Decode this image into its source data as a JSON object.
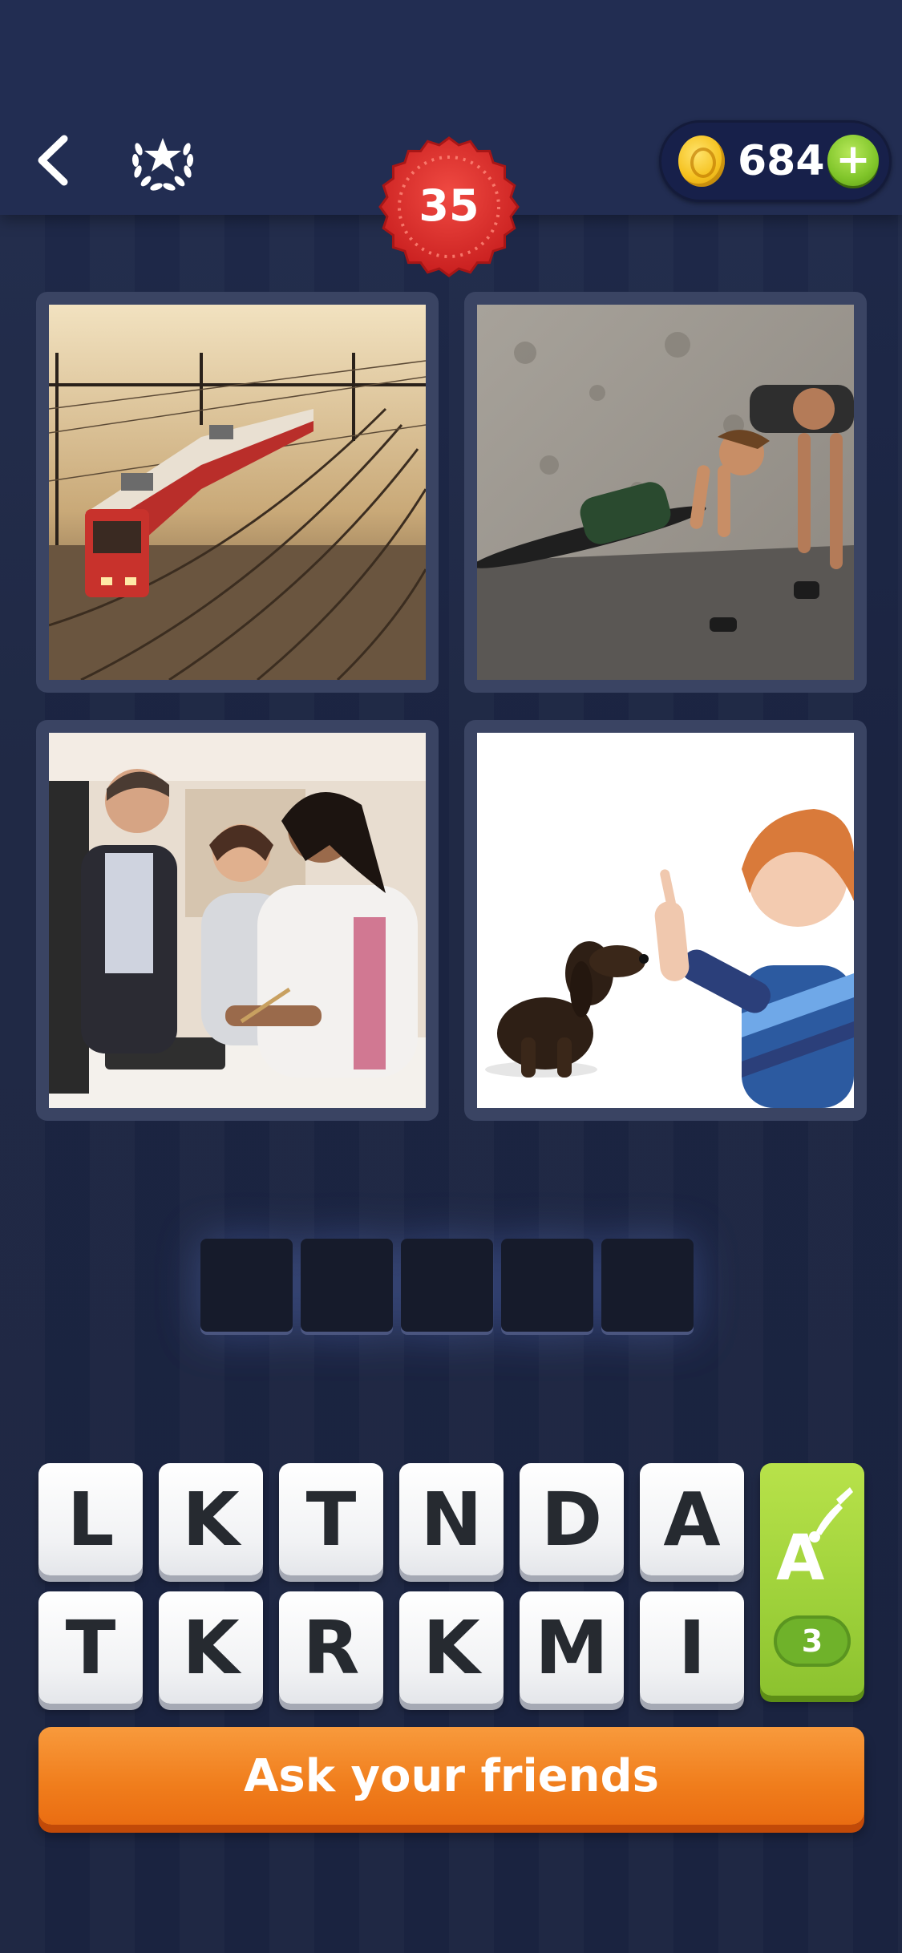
{
  "header": {
    "level": "35",
    "coins": "684",
    "plus_label": "+",
    "back_icon": "chevron-left-icon",
    "laurel_icon": "laurel-star-icon",
    "coin_icon": "coin-icon"
  },
  "pictures": [
    {
      "name": "train-on-tracks"
    },
    {
      "name": "women-doing-pushups"
    },
    {
      "name": "teacher-and-students-at-computer"
    },
    {
      "name": "boy-commanding-dog"
    }
  ],
  "answer_slots": [
    "",
    "",
    "",
    "",
    ""
  ],
  "letters": {
    "row1": [
      "L",
      "K",
      "T",
      "N",
      "D",
      "A"
    ],
    "row2": [
      "T",
      "K",
      "R",
      "K",
      "M",
      "I"
    ]
  },
  "hint": {
    "icon": "letter-a-brush-icon",
    "count": "3"
  },
  "ask_button": "Ask your friends",
  "colors": {
    "background": "#1c2544",
    "level_badge": "#e0302e",
    "plus": "#80c52a",
    "hint": "#9ed13a",
    "ask": "#f07d1c"
  }
}
